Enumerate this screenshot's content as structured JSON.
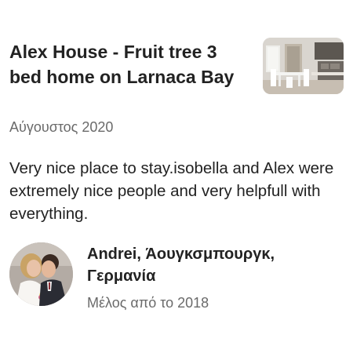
{
  "listing": {
    "title": "Alex House - Fruit tree 3 bed home on Larnaca Bay",
    "thumbnail_icon": "listing-interior-photo"
  },
  "review": {
    "date": "Αύγουστος 2020",
    "text": "Very nice place to stay.isobella and Alex were extremely nice people and very helpfull with everything."
  },
  "reviewer": {
    "name": "Andrei, Άουγκσμπουργκ, Γερμανία",
    "member_since": "Μέλος από το 2018",
    "avatar_icon": "reviewer-avatar-photo"
  },
  "colors": {
    "primary_text": "#222222",
    "secondary_text": "#6a6a6a",
    "background": "#ffffff"
  }
}
